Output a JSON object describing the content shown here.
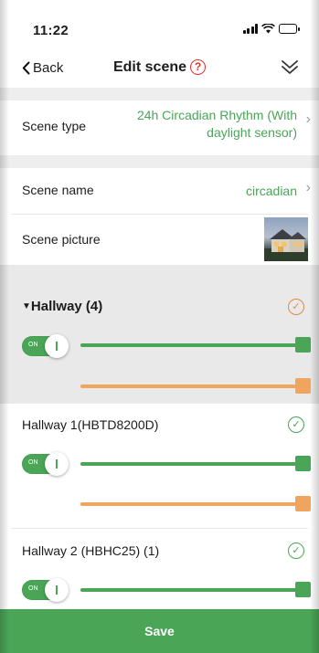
{
  "status": {
    "time": "11:22"
  },
  "nav": {
    "back_label": "Back",
    "title": "Edit scene",
    "help_glyph": "?"
  },
  "scene": {
    "type_label": "Scene type",
    "type_value_line1": "24h Circadian Rhythm (With",
    "type_value_line2": "daylight sensor)",
    "name_label": "Scene name",
    "name_value": "circadian",
    "picture_label": "Scene picture"
  },
  "group": {
    "title": "Hallway (4)",
    "toggle_text": "ON",
    "selected": true
  },
  "devices": [
    {
      "name": "Hallway 1(HBTD8200D)",
      "toggle_text": "ON",
      "selected": true
    },
    {
      "name": "Hallway 2 (HBHC25) (1)",
      "toggle_text": "ON",
      "selected": true
    }
  ],
  "save_label": "Save",
  "icons": {
    "back": "chevron-left-icon",
    "help": "question-circle-icon",
    "collapse": "double-chevron-down-icon",
    "row_chevron": "chevron-right-icon",
    "check": "check-circle-icon",
    "group_expand": "triangle-down-icon"
  },
  "colors": {
    "accent_green": "#4aa557",
    "warm_orange": "#f0a55e",
    "check_orange": "#e0894a",
    "alert_red": "#e03030"
  }
}
